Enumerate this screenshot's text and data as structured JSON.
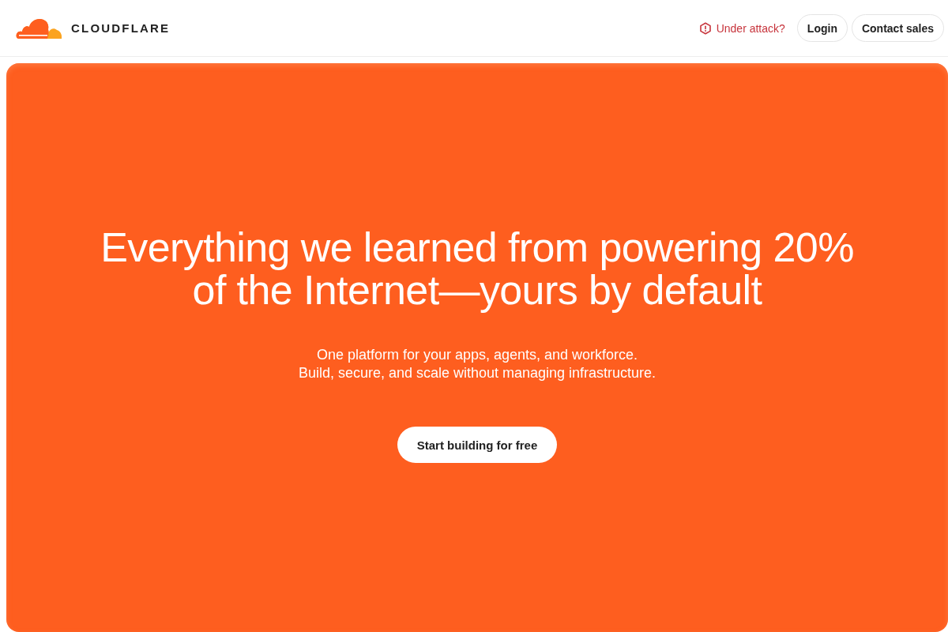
{
  "header": {
    "logo_text": "CLOUDFLARE",
    "alert_link": "Under attack?",
    "buttons": [
      "Login",
      "Contact sales"
    ]
  },
  "hero": {
    "headline_lines": [
      "Everything we learned from powering 20%",
      "of the Internet—yours by default"
    ],
    "subtitle_lines": [
      "One platform for your apps, agents, and workforce.",
      "Build, secure, and scale without managing infrastructure."
    ],
    "cta": "Start building for free"
  }
}
